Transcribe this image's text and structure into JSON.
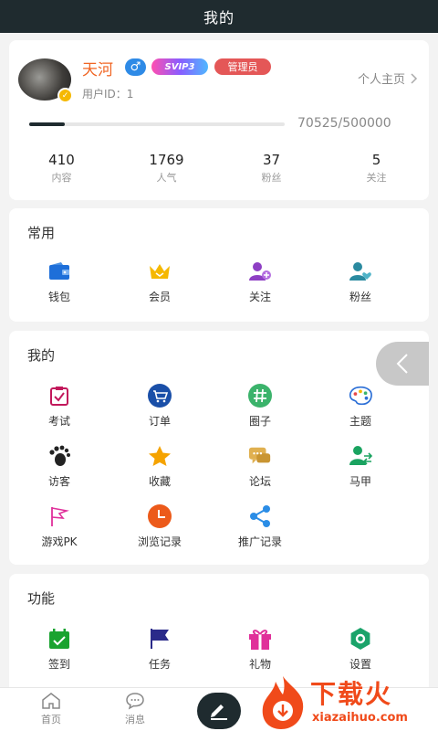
{
  "header": {
    "title": "我的"
  },
  "profile": {
    "username": "天河",
    "gender_symbol": "♂",
    "vip_label": "SVIP3",
    "role_badge": "管理员",
    "uid_label": "用户ID：1",
    "homepage_label": "个人主页",
    "progress_text": "70525/500000",
    "progress_fraction": 0.141,
    "stats": [
      {
        "value": "410",
        "label": "内容"
      },
      {
        "value": "1769",
        "label": "人气"
      },
      {
        "value": "37",
        "label": "粉丝"
      },
      {
        "value": "5",
        "label": "关注"
      }
    ]
  },
  "common": {
    "title": "常用",
    "items": [
      {
        "label": "钱包",
        "icon": "wallet-icon",
        "color": "#1e6fd9"
      },
      {
        "label": "会员",
        "icon": "crown-icon",
        "color": "#f5b800"
      },
      {
        "label": "关注",
        "icon": "user-add-icon",
        "color": "#8e3fc4"
      },
      {
        "label": "粉丝",
        "icon": "user-heart-icon",
        "color": "#2a8aa0"
      }
    ]
  },
  "mine": {
    "title": "我的",
    "items": [
      {
        "label": "考试",
        "icon": "exam-icon",
        "color": "#c2185b"
      },
      {
        "label": "订单",
        "icon": "cart-icon",
        "color": "#1a4fa8"
      },
      {
        "label": "圈子",
        "icon": "hashtag-icon",
        "color": "#3bb36b"
      },
      {
        "label": "主题",
        "icon": "palette-icon",
        "color": "#2c6fd6"
      },
      {
        "label": "访客",
        "icon": "footprint-icon",
        "color": "#222222"
      },
      {
        "label": "收藏",
        "icon": "star-icon",
        "color": "#f5a300"
      },
      {
        "label": "论坛",
        "icon": "chat-icon",
        "color": "#e0b050"
      },
      {
        "label": "马甲",
        "icon": "user-switch-icon",
        "color": "#1aa360"
      },
      {
        "label": "游戏PK",
        "icon": "flag-icon",
        "color": "#e0309a"
      },
      {
        "label": "浏览记录",
        "icon": "clock-icon",
        "color": "#ec5a1a"
      },
      {
        "label": "推广记录",
        "icon": "share-icon",
        "color": "#2b8de6"
      }
    ]
  },
  "func": {
    "title": "功能",
    "items": [
      {
        "label": "签到",
        "icon": "calendar-check-icon",
        "color": "#1aa330"
      },
      {
        "label": "任务",
        "icon": "task-flag-icon",
        "color": "#2a2a8a"
      },
      {
        "label": "礼物",
        "icon": "gift-icon",
        "color": "#e0309a"
      },
      {
        "label": "设置",
        "icon": "settings-icon",
        "color": "#1aa36a"
      }
    ]
  },
  "tabbar": {
    "home_label": "首页",
    "message_label": "消息"
  },
  "watermark": {
    "text": "下载火",
    "sub": "xiazaihuo.com"
  }
}
